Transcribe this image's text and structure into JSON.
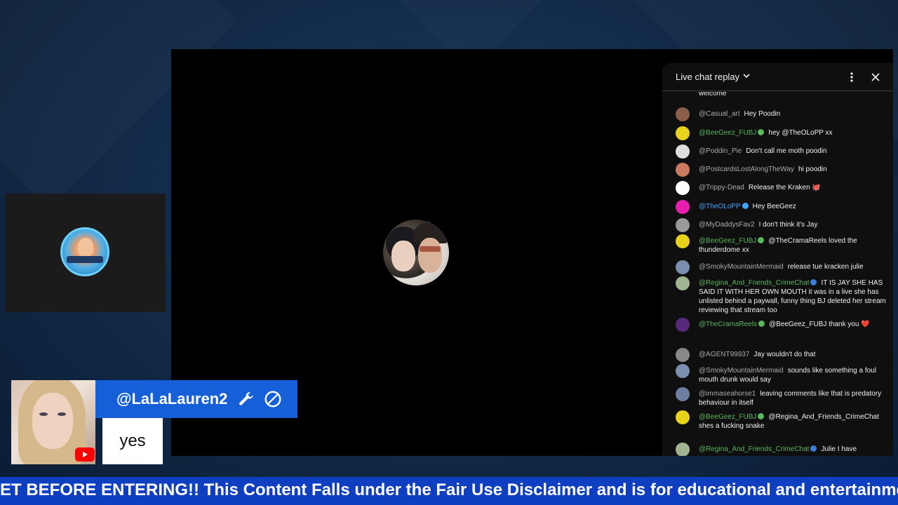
{
  "chat": {
    "title": "Live chat replay",
    "menu_icon": "more-vert-icon",
    "close_icon": "close-icon",
    "messages": [
      {
        "author": "",
        "text": "welcome",
        "color": "#aaaaaa",
        "avatar_color": "#555555"
      },
      {
        "author": "@Casual_art",
        "text": "Hey Poodin",
        "color": "#aaaaaa",
        "avatar_color": "#8b5e4a"
      },
      {
        "author": "@BeeGeez_FUBJ",
        "text": "hey @TheOLoPP xx",
        "color": "#5ab65f",
        "avatar_color": "#e8d21a",
        "mod": true
      },
      {
        "author": "@Poddin_Pie",
        "text": "Don't call me moth poodin",
        "color": "#aaaaaa",
        "avatar_color": "#dddddd"
      },
      {
        "author": "@PostcardsLostAlongTheWay",
        "text": "hi poodin",
        "color": "#aaaaaa",
        "avatar_color": "#c97a5f"
      },
      {
        "author": "@Trippy-Dead",
        "text": "Release the Kraken 🐙",
        "color": "#aaaaaa",
        "avatar_color": "#ffffff"
      },
      {
        "author": "@TheOLoPP",
        "text": "Hey BeeGeez",
        "color": "#3ea6ff",
        "avatar_color": "#e91eb0",
        "owner": true
      },
      {
        "author": "@MyDaddysFav2",
        "text": "I don't think it's Jay",
        "color": "#aaaaaa",
        "avatar_color": "#9a9a9a"
      },
      {
        "author": "@BeeGeez_FUBJ",
        "text": "@TheCramaReels loved the thunderdome xx",
        "color": "#5ab65f",
        "avatar_color": "#e8d21a",
        "mod": true
      },
      {
        "author": "@SmokyMountainMermaid",
        "text": "release tue kracken julie",
        "color": "#aaaaaa",
        "avatar_color": "#7a8fb0"
      },
      {
        "author": "@Regina_And_Friends_CrimeChat",
        "text": "IT IS JAY SHE HAS SAID IT WITH HER OWN MOUTH it was in a live she has unlisted behind a paywall, funny thing BJ deleted her stream reviewing that stream too",
        "color": "#5ab65f",
        "avatar_color": "#9fb58f",
        "member": true
      },
      {
        "author": "@TheCramaReels",
        "text": "@BeeGeez_FUBJ thank you ❤️",
        "color": "#5ab65f",
        "avatar_color": "#5a2a7a",
        "mod": true
      },
      {
        "author": "@AGENT99937",
        "text": "Jay wouldn't do that",
        "color": "#aaaaaa",
        "avatar_color": "#888888"
      },
      {
        "author": "@SmokyMountainMermaid",
        "text": "sounds like something a foul mouth drunk would say",
        "color": "#aaaaaa",
        "avatar_color": "#7a8fb0"
      },
      {
        "author": "@immaseahorse1",
        "text": "leaving comments like that is predatory behaviour in itself",
        "color": "#aaaaaa",
        "avatar_color": "#6d7fa0"
      },
      {
        "author": "@BeeGeez_FUBJ",
        "text": "@Regina_And_Friends_CrimeChat shes a fucking snake",
        "color": "#5ab65f",
        "avatar_color": "#e8d21a",
        "mod": true
      },
      {
        "author": "@Regina_And_Friends_CrimeChat",
        "text": "Julie I have",
        "color": "#5ab65f",
        "avatar_color": "#9fb58f",
        "member": true
      }
    ]
  },
  "name_card": {
    "username": "@LaLaLauren2",
    "wrench_icon": "wrench-icon",
    "block_icon": "block-icon",
    "reply": "yes",
    "platform_icon": "youtube-icon"
  },
  "ticker": {
    "text": "ET BEFORE ENTERING!! This Content Falls under the Fair Use Disclaimer and is for educational and entertainment"
  },
  "colors": {
    "ticker_bg": "#0f3fc1",
    "name_card_bg": "#1560d8",
    "mod_green": "#5ab65f",
    "owner_blue": "#3ea6ff"
  }
}
